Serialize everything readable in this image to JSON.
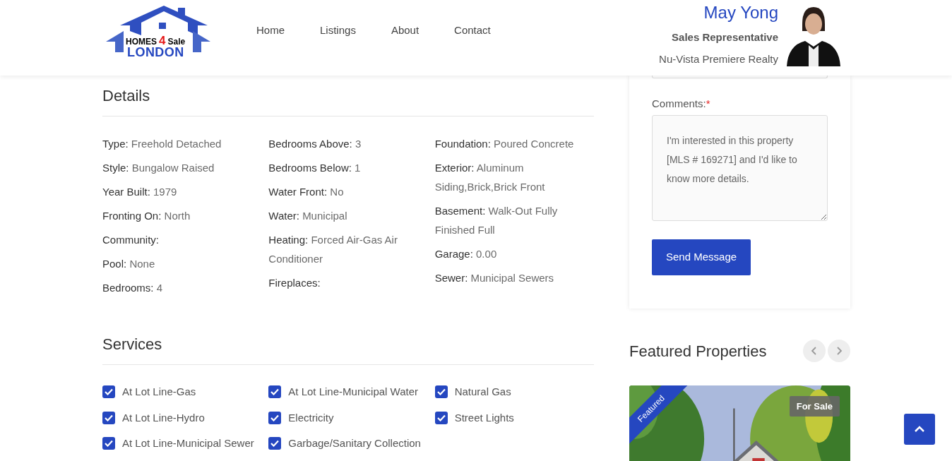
{
  "logo": {
    "line1_left": "HOMES",
    "line1_number": "4",
    "line1_right": "Sale",
    "line2": "LONDON"
  },
  "nav": [
    {
      "label": "Home"
    },
    {
      "label": "Listings"
    },
    {
      "label": "About"
    },
    {
      "label": "Contact"
    }
  ],
  "agent": {
    "name": "May Yong",
    "title": "Sales Representative",
    "brokerage": "Nu-Vista Premiere Realty"
  },
  "details": {
    "heading": "Details",
    "columns": [
      [
        {
          "label": "Type:",
          "value": "Freehold Detached"
        },
        {
          "label": "Style:",
          "value": "Bungalow Raised"
        },
        {
          "label": "Year Built:",
          "value": "1979"
        },
        {
          "label": "Fronting On:",
          "value": "North"
        },
        {
          "label": "Community:"
        },
        {
          "label": "Pool:",
          "value": "None"
        },
        {
          "label": "Bedrooms:",
          "value": "4"
        }
      ],
      [
        {
          "label": "Bedrooms Above:",
          "value": "3"
        },
        {
          "label": "Bedrooms Below:",
          "value": "1"
        },
        {
          "label": "Water Front:",
          "value": "No"
        },
        {
          "label": "Water:",
          "value": "Municipal"
        },
        {
          "label": "Heating:",
          "value": "Forced Air-Gas Air Conditioner"
        },
        {
          "label": "Fireplaces:"
        }
      ],
      [
        {
          "label": "Foundation:",
          "value": "Poured Concrete"
        },
        {
          "label": "Exterior:",
          "value": "Aluminum Siding,Brick,Brick Front"
        },
        {
          "label": "Basement:",
          "value": "Walk-Out Fully Finished Full"
        },
        {
          "label": "Garage:",
          "value": "0.00"
        },
        {
          "label": "Sewer:",
          "value": "Municipal Sewers"
        }
      ]
    ]
  },
  "services": {
    "heading": "Services",
    "columns": [
      [
        {
          "label": "At Lot Line-Gas",
          "checked": true
        },
        {
          "label": "At Lot Line-Hydro",
          "checked": true
        },
        {
          "label": "At Lot Line-Municipal Sewer",
          "checked": true
        }
      ],
      [
        {
          "label": "At Lot Line-Municipal Water",
          "checked": true
        },
        {
          "label": "Electricity",
          "checked": true
        },
        {
          "label": "Garbage/Sanitary Collection",
          "checked": true
        }
      ],
      [
        {
          "label": "Natural Gas",
          "checked": true
        },
        {
          "label": "Street Lights",
          "checked": true
        }
      ]
    ]
  },
  "contact_form": {
    "comments_label": "Comments:",
    "required_mark": "*",
    "comments_value": "I'm interested in this property [MLS # 169271] and I'd like to know more details.",
    "submit": "Send Message"
  },
  "featured": {
    "heading": "Featured Properties",
    "card": {
      "ribbon": "Featured",
      "status": "For Sale"
    }
  }
}
